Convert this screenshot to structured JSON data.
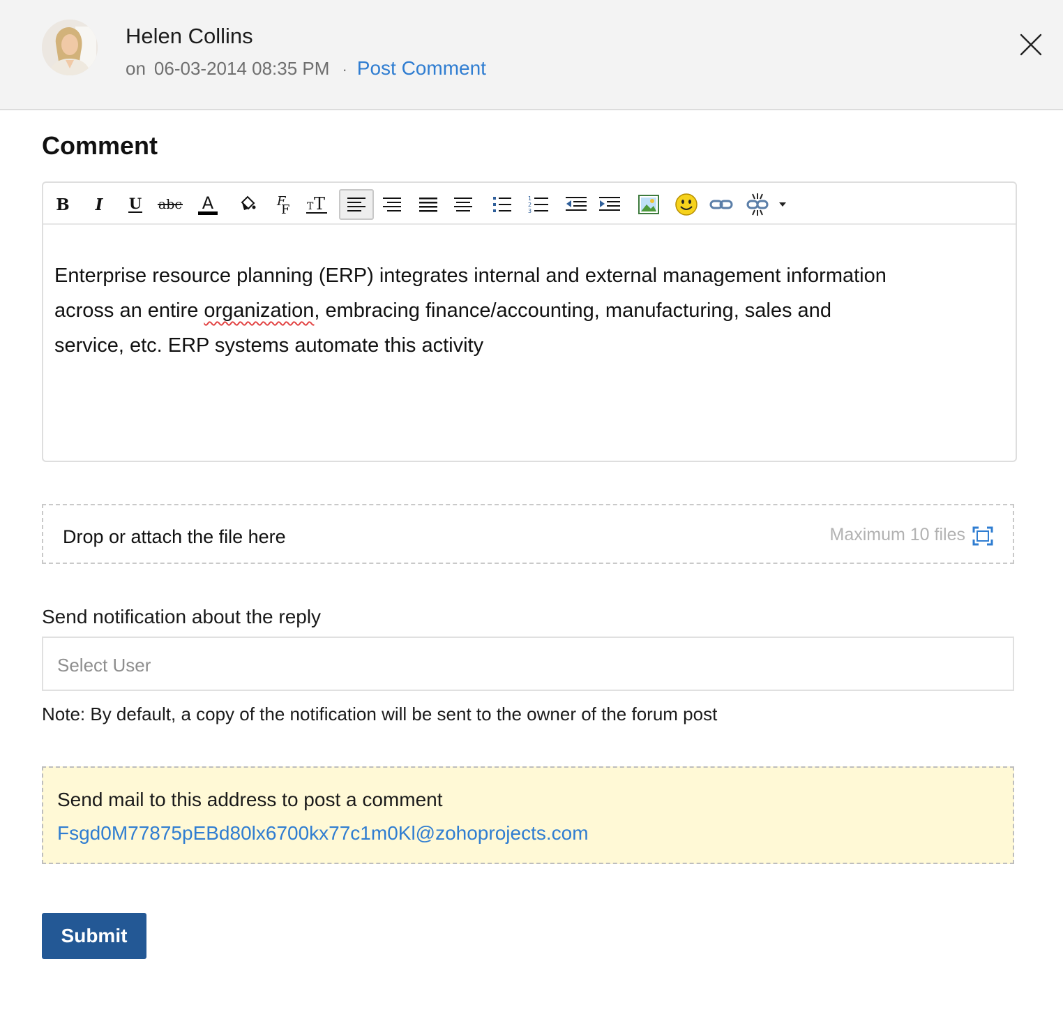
{
  "header": {
    "author": "Helen Collins",
    "on_label": "on",
    "timestamp": "06-03-2014 08:35 PM",
    "separator": "·",
    "action_link": "Post Comment"
  },
  "section_title": "Comment",
  "toolbar": {
    "buttons": [
      "bold-icon",
      "italic-icon",
      "underline-icon",
      "strikethrough-icon",
      "font-color-icon",
      "background-color-icon",
      "font-family-icon",
      "font-size-icon",
      "align-left-icon",
      "align-right-icon",
      "justify-icon",
      "align-center-icon",
      "bullet-list-icon",
      "numbered-list-icon",
      "outdent-icon",
      "indent-icon",
      "insert-image-icon",
      "emoji-icon",
      "insert-link-icon",
      "remove-link-icon",
      "more-dropdown-icon"
    ]
  },
  "editor": {
    "line1": "Enterprise resource planning (ERP) integrates internal and external management information",
    "line2_a": "across an entire ",
    "line2_spell": "organization",
    "line2_b": ", embracing finance/accounting, manufacturing, sales and",
    "line3": "service, etc. ERP systems automate this activity"
  },
  "attachments": {
    "label": "Drop or attach the file here",
    "max_label": "Maximum 10 files"
  },
  "notification": {
    "label": "Send notification about the reply",
    "placeholder": "Select User",
    "note": "Note: By default, a copy of the notification will be sent to the owner of the forum post"
  },
  "mail": {
    "label": "Send mail to this address to post a comment",
    "address": "Fsgd0M77875pEBd80lx6700kx77c1m0Kl@zohoprojects.com"
  },
  "submit_label": "Submit",
  "colors": {
    "link": "#2f7dd1",
    "submit": "#235895",
    "mail_bg": "#fff9d6"
  }
}
